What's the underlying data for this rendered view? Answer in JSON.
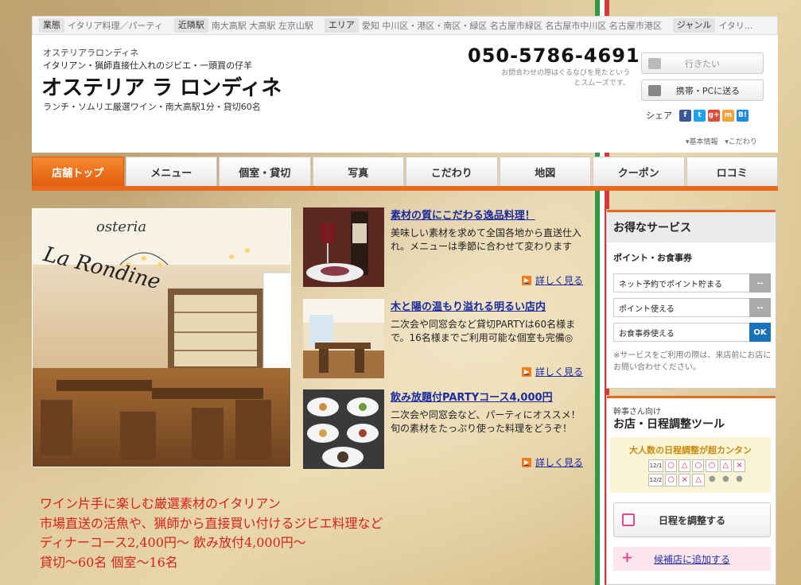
{
  "topbar": {
    "items": [
      {
        "label": "業態",
        "value": "イタリア料理／パーティ"
      },
      {
        "label": "近隣駅",
        "value": "南大高駅 大高駅 左京山駅"
      },
      {
        "label": "エリア",
        "value": "愛知 中川区・港区・南区・緑区 名古屋市緑区 名古屋市中川区 名古屋市港区"
      },
      {
        "label": "ジャンル",
        "value": "イタリ..."
      }
    ]
  },
  "header": {
    "small_name": "オステリアラロンディネ",
    "subtitle": "イタリアン・猟師直接仕入れのジビエ・一頭買の仔羊",
    "title": "オステリア ラ ロンディネ",
    "tagline": "ランチ・ソムリエ厳選ワイン・南大高駅1分・貸切60名",
    "phone": "050-5786-4691",
    "phone_note": "お問合わせの際はぐるなびを見たというとスムーズです。",
    "want_button": "行きたい",
    "send_button": "携帯・PCに送る",
    "share_label": "シェア",
    "link_basic": "▾基本情報",
    "link_kodawari": "▾こだわり"
  },
  "nav": {
    "tabs": [
      "店舗トップ",
      "メニュー",
      "個室・貸切",
      "写真",
      "こだわり",
      "地図",
      "クーポン",
      "ロコミ"
    ]
  },
  "hero": {
    "logo_line1": "osteria",
    "logo_line2": "La Rondine"
  },
  "features": [
    {
      "title": "素材の質にこだわる逸品料理！",
      "text": "美味しい素材を求めて全国各地から直送仕入れ。メニューは季節に合わせて変わります",
      "more": "詳しく見る"
    },
    {
      "title": "木と陽の温もり溢れる明るい店内",
      "text": "二次会や同窓会など貸切PARTYは60名様まで。16名様までご利用可能な個室も完備◎",
      "more": "詳しく見る"
    },
    {
      "title": "飲み放題付PARTYコース4,000円",
      "text": "二次会や同窓会など、パーティにオススメ！旬の素材をたっぷり使った料理をどうぞ！",
      "more": "詳しく見る"
    }
  ],
  "promo": {
    "lines": [
      "ワイン片手に楽しむ厳選素材のイタリアン",
      "市場直送の活魚や、猟師から直接買い付けるジビエ料理など",
      "ディナーコース2,400円〜 飲み放付4,000円〜",
      "貸切〜60名 個室〜16名"
    ]
  },
  "services": {
    "title": "お得なサービス",
    "subtitle": "ポイント・お食事券",
    "rows": [
      {
        "label": "ネット予約でポイント貯まる",
        "btn": "--"
      },
      {
        "label": "ポイント使える",
        "btn": "--"
      },
      {
        "label": "お食事券使える",
        "btn": "OK"
      }
    ],
    "note": "※サービスをご利用の際は、来店前にお店にお問い合わせください。"
  },
  "schedule": {
    "small": "幹事さん向け",
    "title": "お店・日程調整ツール",
    "caption": "大人数の日程調整が超カンタン",
    "date1": "12/1",
    "date2": "12/2",
    "button": "日程を調整する",
    "add_link": "候補店に追加する"
  },
  "colors": {
    "accent": "#e86a1a",
    "link": "#1a2aa0",
    "promo": "#d8221a"
  }
}
